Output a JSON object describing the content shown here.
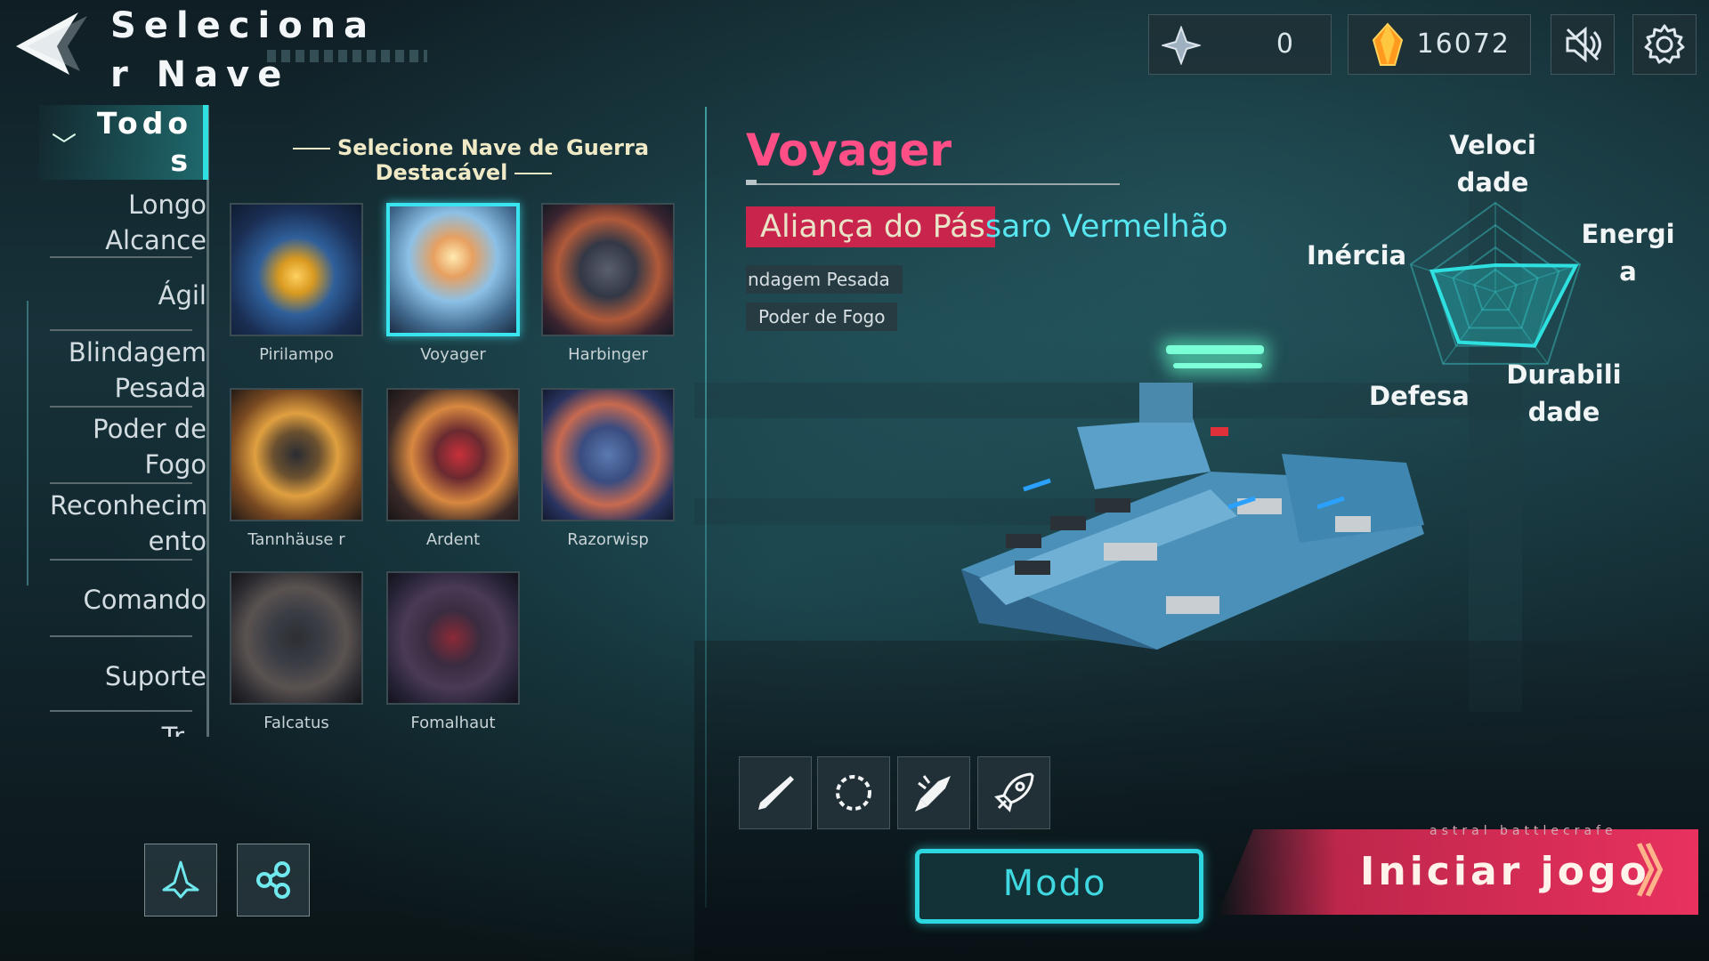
{
  "header": {
    "title": "Seleciona r Nave",
    "resources": [
      {
        "name": "ship-token",
        "value": "0"
      },
      {
        "name": "crystal",
        "value": "16072"
      }
    ]
  },
  "categories": {
    "active": "Todo s",
    "items": [
      "Longo Alcance",
      "Ágil",
      "Blindagem Pesada",
      "Poder de Fogo",
      "Reconhecim ento",
      "Comando",
      "Suporte",
      "Tr..."
    ]
  },
  "ship_grid": {
    "title": "Selecione Nave de Guerra Destacável",
    "ships": [
      {
        "name": "Pirilampo",
        "selected": false
      },
      {
        "name": "Voyager",
        "selected": true
      },
      {
        "name": "Harbinger",
        "selected": false
      },
      {
        "name": "Tannhäuse r",
        "selected": false
      },
      {
        "name": "Ardent",
        "selected": false
      },
      {
        "name": "Razorwisp",
        "selected": false
      },
      {
        "name": "Falcatus",
        "selected": false
      },
      {
        "name": "Fomalhaut",
        "selected": false
      }
    ]
  },
  "ship_info": {
    "name": "Voyager",
    "faction_prefix": "Aliança do Pás",
    "faction_suffix": "saro Vermelhão",
    "tags": [
      "ndagem Pesada",
      "Poder de Fogo"
    ]
  },
  "radar": {
    "labels": {
      "speed": "Veloci dade",
      "energy": "Energi a",
      "durability": "Durabili dade",
      "defense": "Defesa",
      "inertia": "Inércia"
    },
    "values": {
      "speed": 0.3,
      "energy": 0.95,
      "durability": 0.75,
      "defense": 0.7,
      "inertia": 0.75
    }
  },
  "abilities": [
    "blade-icon",
    "shield-ring-icon",
    "missile-icon",
    "rocket-icon"
  ],
  "buttons": {
    "mode": "Modo",
    "start": "Iniciar jogo",
    "start_chevron": "》"
  },
  "brand": "astral battlecrafe",
  "colors": {
    "accent_cyan": "#2fe0e0",
    "accent_pink": "#ff4f86",
    "start_red": "#e8315f"
  }
}
